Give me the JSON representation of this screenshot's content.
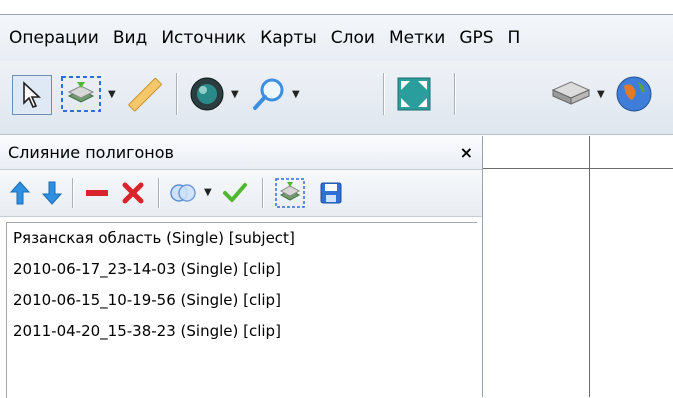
{
  "menubar": {
    "items": [
      "Операции",
      "Вид",
      "Источник",
      "Карты",
      "Слои",
      "Метки",
      "GPS",
      "П"
    ]
  },
  "panel": {
    "title": "Слияние полигонов",
    "close_label": "×",
    "toolbar": {
      "icons": [
        "arrow-up-icon",
        "arrow-down-icon",
        "minus-icon",
        "delete-icon",
        "merge-icon",
        "ok-icon",
        "layer-icon",
        "save-icon"
      ]
    },
    "items": [
      "Рязанская область (Single) [subject]",
      "2010-06-17_23-14-03 (Single) [clip]",
      "2010-06-15_10-19-56 (Single) [clip]",
      "2011-04-20_15-38-23 (Single) [clip]"
    ]
  },
  "colors": {
    "blue_arrow": "#2f8fe0",
    "red": "#d9242c",
    "green_check": "#4fb830",
    "teal": "#2a9d9d"
  }
}
